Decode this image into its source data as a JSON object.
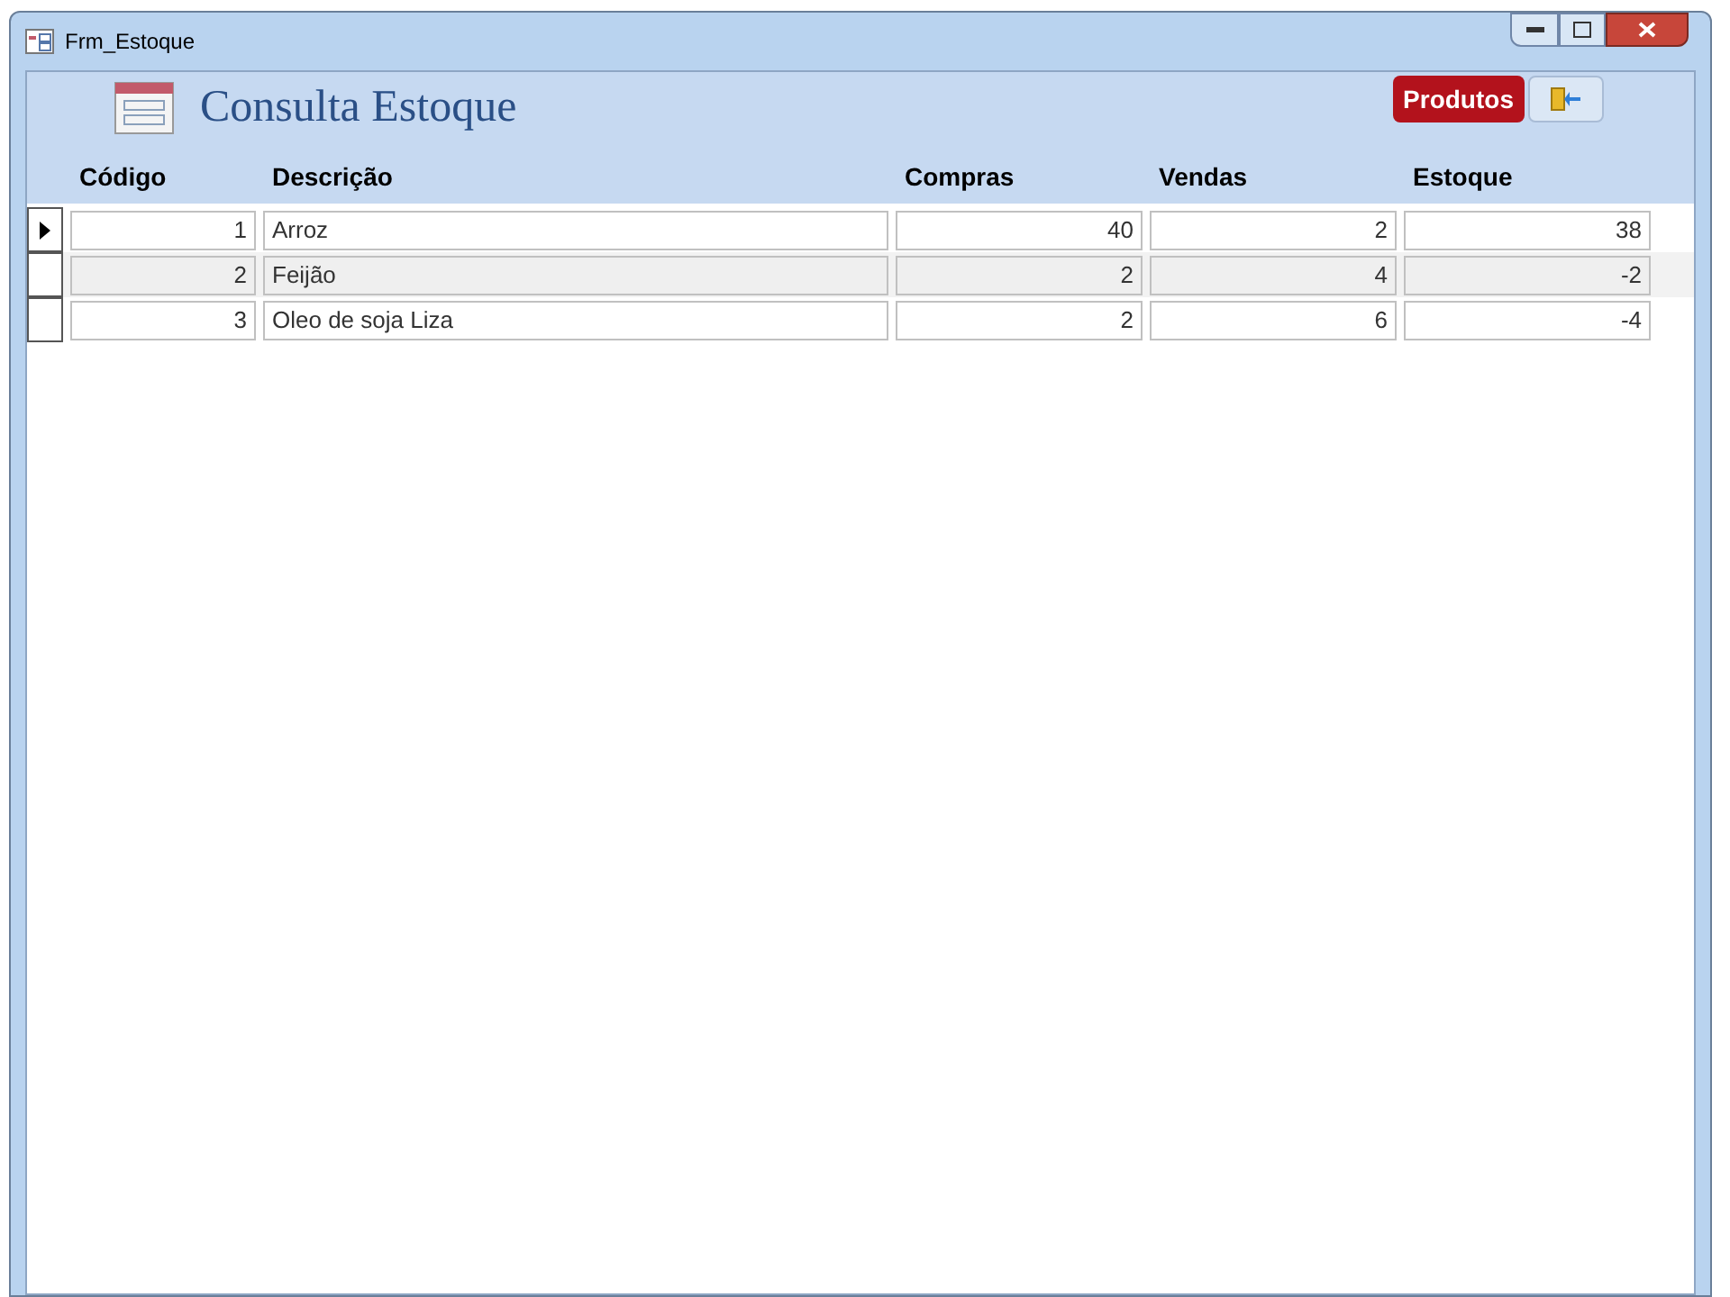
{
  "window": {
    "title": "Frm_Estoque"
  },
  "header": {
    "title": "Consulta Estoque",
    "buttons": [
      {
        "kind": "text",
        "label": "Produtos"
      },
      {
        "kind": "exit"
      }
    ]
  },
  "table": {
    "columns": [
      "Código",
      "Descrição",
      "Compras",
      "Vendas",
      "Estoque"
    ],
    "rows": [
      {
        "selected": true,
        "cells": [
          "1",
          "Arroz",
          "40",
          "2",
          "38"
        ]
      },
      {
        "selected": false,
        "cells": [
          "2",
          "Feijão",
          "2",
          "4",
          "-2"
        ]
      },
      {
        "selected": false,
        "cells": [
          "3",
          "Oleo de soja Liza",
          "2",
          "6",
          "-4"
        ]
      }
    ]
  }
}
